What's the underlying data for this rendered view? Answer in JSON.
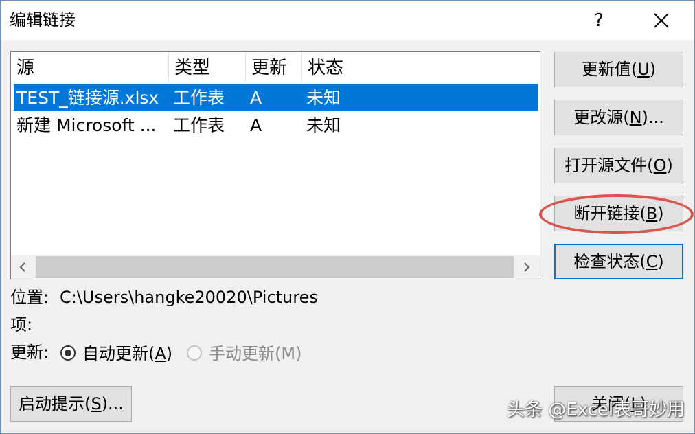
{
  "window": {
    "title": "编辑链接",
    "help": "?"
  },
  "list": {
    "columns": [
      "源",
      "类型",
      "更新",
      "状态"
    ],
    "rows": [
      {
        "source": "TEST_链接源.xlsx",
        "type": "工作表",
        "update": "A",
        "status": "未知",
        "selected": true
      },
      {
        "source": "新建 Microsoft ...",
        "type": "工作表",
        "update": "A",
        "status": "未知",
        "selected": false
      }
    ]
  },
  "buttons": {
    "update_values": {
      "pre": "更新值(",
      "key": "U",
      "post": ")"
    },
    "change_source": {
      "pre": "更改源(",
      "key": "N",
      "post": ")..."
    },
    "open_source": {
      "pre": "打开源文件(",
      "key": "O",
      "post": ")"
    },
    "break_link": {
      "pre": "断开链接(",
      "key": "B",
      "post": ")"
    },
    "check_status": {
      "pre": "检查状态(",
      "key": "C",
      "post": ")"
    },
    "startup_prompt": {
      "pre": "启动提示(",
      "key": "S",
      "post": ")..."
    },
    "close": {
      "pre": "关闭(",
      "key": "L",
      "post": ")"
    }
  },
  "info": {
    "location_label": "位置:",
    "location_value": "C:\\Users\\hangke20020\\Pictures",
    "item_label": "项:",
    "update_label": "更新:",
    "auto_update": {
      "pre": "自动更新(",
      "key": "A",
      "post": ")"
    },
    "manual_update": "手动更新(M)"
  },
  "watermark": "头条 @Excel表哥妙用",
  "colors": {
    "selection": "#0078d7",
    "highlight_ellipse": "#d9534f"
  }
}
